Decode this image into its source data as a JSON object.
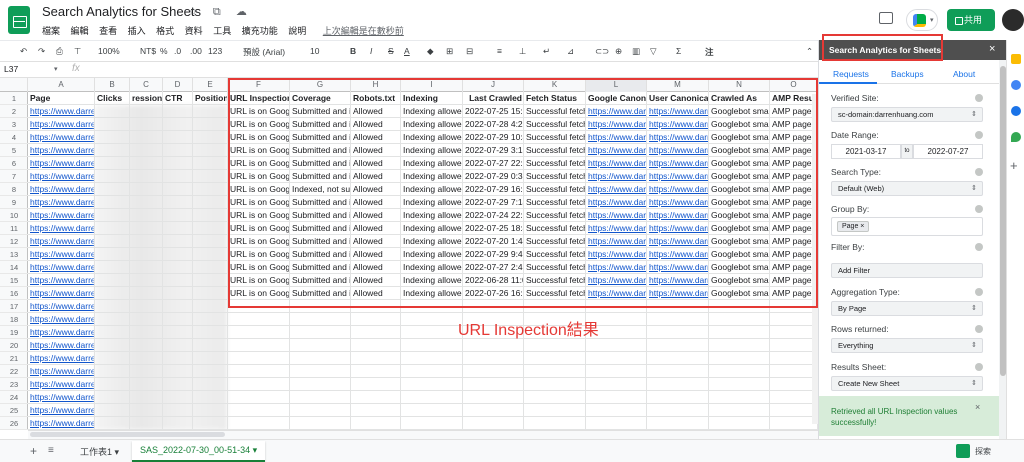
{
  "header": {
    "title": "Search Analytics for Sheets",
    "title_icons": "☆ ⧉ ☁",
    "menus": [
      "檔案",
      "編輯",
      "查看",
      "插入",
      "格式",
      "資料",
      "工具",
      "擴充功能",
      "說明"
    ],
    "last_edit": "上次編輯是在數秒前",
    "share_label": "共用"
  },
  "toolbar": {
    "undo": "↶",
    "redo": "↷",
    "print": "⎙",
    "paint": "⊤",
    "zoom": "100%",
    "currency": "NT$",
    "percent": "%",
    "dec_dec": ".0",
    "dec_inc": ".00",
    "more_formats": "123",
    "font": "預設 (Arial)",
    "font_size": "10",
    "bold": "B",
    "italic": "I",
    "strike": "S",
    "text_color": "A",
    "fill": "◆",
    "borders": "⊞",
    "merge": "⊟",
    "halign": "≡",
    "valign": "⊥",
    "wrap": "↵",
    "rotate": "⊿",
    "link": "⊂⊃",
    "comment": "⊕",
    "chart": "▥",
    "filter": "▽",
    "functions": "Σ",
    "input_tools": "注",
    "collapse": "⌃"
  },
  "formula_bar": {
    "name_box": "L37",
    "fx": "fx"
  },
  "columns": [
    "A",
    "B",
    "C",
    "D",
    "E",
    "F",
    "G",
    "H",
    "I",
    "J",
    "K",
    "L",
    "M",
    "N",
    "O"
  ],
  "rows": [
    "1",
    "2",
    "3",
    "4",
    "5",
    "6",
    "7",
    "8",
    "9",
    "10",
    "11",
    "12",
    "13",
    "14",
    "15",
    "16",
    "17",
    "18",
    "19",
    "20",
    "21",
    "22",
    "23",
    "24",
    "25",
    "26"
  ],
  "header_row": {
    "A": "Page",
    "B": "Clicks",
    "C": "ressions",
    "D": "CTR",
    "E": "Position",
    "F": "URL Inspection",
    "G": "Coverage",
    "H": "Robots.txt",
    "I": "Indexing",
    "J": "Last Crawled",
    "K": "Fetch Status",
    "L": "Google Canonic",
    "M": "User Canonical",
    "N": "Crawled As",
    "O": "AMP Resu"
  },
  "page_link": "https://www.darre",
  "inspection_rows": [
    {
      "F": "URL is on Googl",
      "G": "Submitted and ir",
      "H": "Allowed",
      "I": "Indexing allowed",
      "J": "2022-07-25 15:1",
      "K": "Successful fetch",
      "L": "https://www.darre",
      "M": "https://www.darre",
      "N": "Googlebot smart",
      "O": "AMP page"
    },
    {
      "F": "URL is on Googl",
      "G": "Submitted and ir",
      "H": "Allowed",
      "I": "Indexing allowed",
      "J": "2022-07-28 4:29",
      "K": "Successful fetch",
      "L": "https://www.darre",
      "M": "https://www.darre",
      "N": "Googlebot smart",
      "O": "AMP page"
    },
    {
      "F": "URL is on Googl",
      "G": "Submitted and ir",
      "H": "Allowed",
      "I": "Indexing allowed",
      "J": "2022-07-29 10:4",
      "K": "Successful fetch",
      "L": "https://www.darre",
      "M": "https://www.darre",
      "N": "Googlebot smart",
      "O": "AMP page"
    },
    {
      "F": "URL is on Googl",
      "G": "Submitted and ir",
      "H": "Allowed",
      "I": "Indexing allowed",
      "J": "2022-07-29 3:12",
      "K": "Successful fetch",
      "L": "https://www.darre",
      "M": "https://www.darre",
      "N": "Googlebot smart",
      "O": "AMP page"
    },
    {
      "F": "URL is on Googl",
      "G": "Submitted and ir",
      "H": "Allowed",
      "I": "Indexing allowed",
      "J": "2022-07-27 22:1",
      "K": "Successful fetch",
      "L": "https://www.darre",
      "M": "https://www.darre",
      "N": "Googlebot smart",
      "O": "AMP page"
    },
    {
      "F": "URL is on Googl",
      "G": "Submitted and ir",
      "H": "Allowed",
      "I": "Indexing allowed",
      "J": "2022-07-29 0:36",
      "K": "Successful fetch",
      "L": "https://www.darre",
      "M": "https://www.darre",
      "N": "Googlebot smart",
      "O": "AMP page"
    },
    {
      "F": "URL is on Googl",
      "G": "Indexed, not sub",
      "H": "Allowed",
      "I": "Indexing allowed",
      "J": "2022-07-29 16:0",
      "K": "Successful fetch",
      "L": "https://www.darre",
      "M": "https://www.darre",
      "N": "Googlebot smart",
      "O": "AMP page"
    },
    {
      "F": "URL is on Googl",
      "G": "Submitted and ir",
      "H": "Allowed",
      "I": "Indexing allowed",
      "J": "2022-07-29 7:14",
      "K": "Successful fetch",
      "L": "https://www.darre",
      "M": "https://www.darre",
      "N": "Googlebot smart",
      "O": "AMP page"
    },
    {
      "F": "URL is on Googl",
      "G": "Submitted and ir",
      "H": "Allowed",
      "I": "Indexing allowed",
      "J": "2022-07-24 22:3",
      "K": "Successful fetch",
      "L": "https://www.darre",
      "M": "https://www.darre",
      "N": "Googlebot smart",
      "O": "AMP page"
    },
    {
      "F": "URL is on Googl",
      "G": "Submitted and ir",
      "H": "Allowed",
      "I": "Indexing allowed",
      "J": "2022-07-25 18:4",
      "K": "Successful fetch",
      "L": "https://www.darre",
      "M": "https://www.darre",
      "N": "Googlebot smart",
      "O": "AMP page"
    },
    {
      "F": "URL is on Googl",
      "G": "Submitted and ir",
      "H": "Allowed",
      "I": "Indexing allowed",
      "J": "2022-07-20 1:44",
      "K": "Successful fetch",
      "L": "https://www.darre",
      "M": "https://www.darre",
      "N": "Googlebot smart",
      "O": "AMP page"
    },
    {
      "F": "URL is on Googl",
      "G": "Submitted and ir",
      "H": "Allowed",
      "I": "Indexing allowed",
      "J": "2022-07-29 9:42",
      "K": "Successful fetch",
      "L": "https://www.darre",
      "M": "https://www.darre",
      "N": "Googlebot smart",
      "O": "AMP page"
    },
    {
      "F": "URL is on Googl",
      "G": "Submitted and ir",
      "H": "Allowed",
      "I": "Indexing allowed",
      "J": "2022-07-27 2:41",
      "K": "Successful fetch",
      "L": "https://www.darre",
      "M": "https://www.darre",
      "N": "Googlebot smart",
      "O": "AMP page"
    },
    {
      "F": "URL is on Googl",
      "G": "Submitted and ir",
      "H": "Allowed",
      "I": "Indexing allowed",
      "J": "2022-06-28 11:0",
      "K": "Successful fetch",
      "L": "https://www.darre",
      "M": "https://www.darre",
      "N": "Googlebot smart",
      "O": "AMP page"
    },
    {
      "F": "URL is on Googl",
      "G": "Submitted and ir",
      "H": "Allowed",
      "I": "Indexing allowed",
      "J": "2022-07-26 16:1",
      "K": "Successful fetch",
      "L": "https://www.darre",
      "M": "https://www.darre",
      "N": "Googlebot smart",
      "O": "AMP page"
    }
  ],
  "annotation": "URL Inspection結果",
  "sheet_tabs": {
    "add": "+",
    "all": "≡",
    "tab1": "工作表1 ▾",
    "tab2": "SAS_2022-07-30_00-51-34 ▾",
    "explore": "探索"
  },
  "sidebar": {
    "title": "Search Analytics for Sheets",
    "close": "×",
    "tabs": [
      "Requests",
      "Backups",
      "About"
    ],
    "verified_site_label": "Verified Site:",
    "verified_site": "sc-domain:darrenhuang.com",
    "date_range_label": "Date Range:",
    "date_from": "2021-03-17",
    "date_to_sep": "to",
    "date_to": "2022-07-27",
    "search_type_label": "Search Type:",
    "search_type": "Default (Web)",
    "group_by_label": "Group By:",
    "group_by_chip": "Page ×",
    "filter_by_label": "Filter By:",
    "add_filter": "Add Filter",
    "aggregation_label": "Aggregation Type:",
    "aggregation": "By Page",
    "rows_label": "Rows returned:",
    "rows": "Everything",
    "results_label": "Results Sheet:",
    "results": "Create New Sheet",
    "success_msg": "Retrieved all URL Inspection values successfully!",
    "success_close": "×",
    "select_arrow": "⇕"
  },
  "colors": {
    "brand_green": "#0f9d58",
    "annotation_red": "#e53935",
    "link_blue": "#1155cc"
  }
}
